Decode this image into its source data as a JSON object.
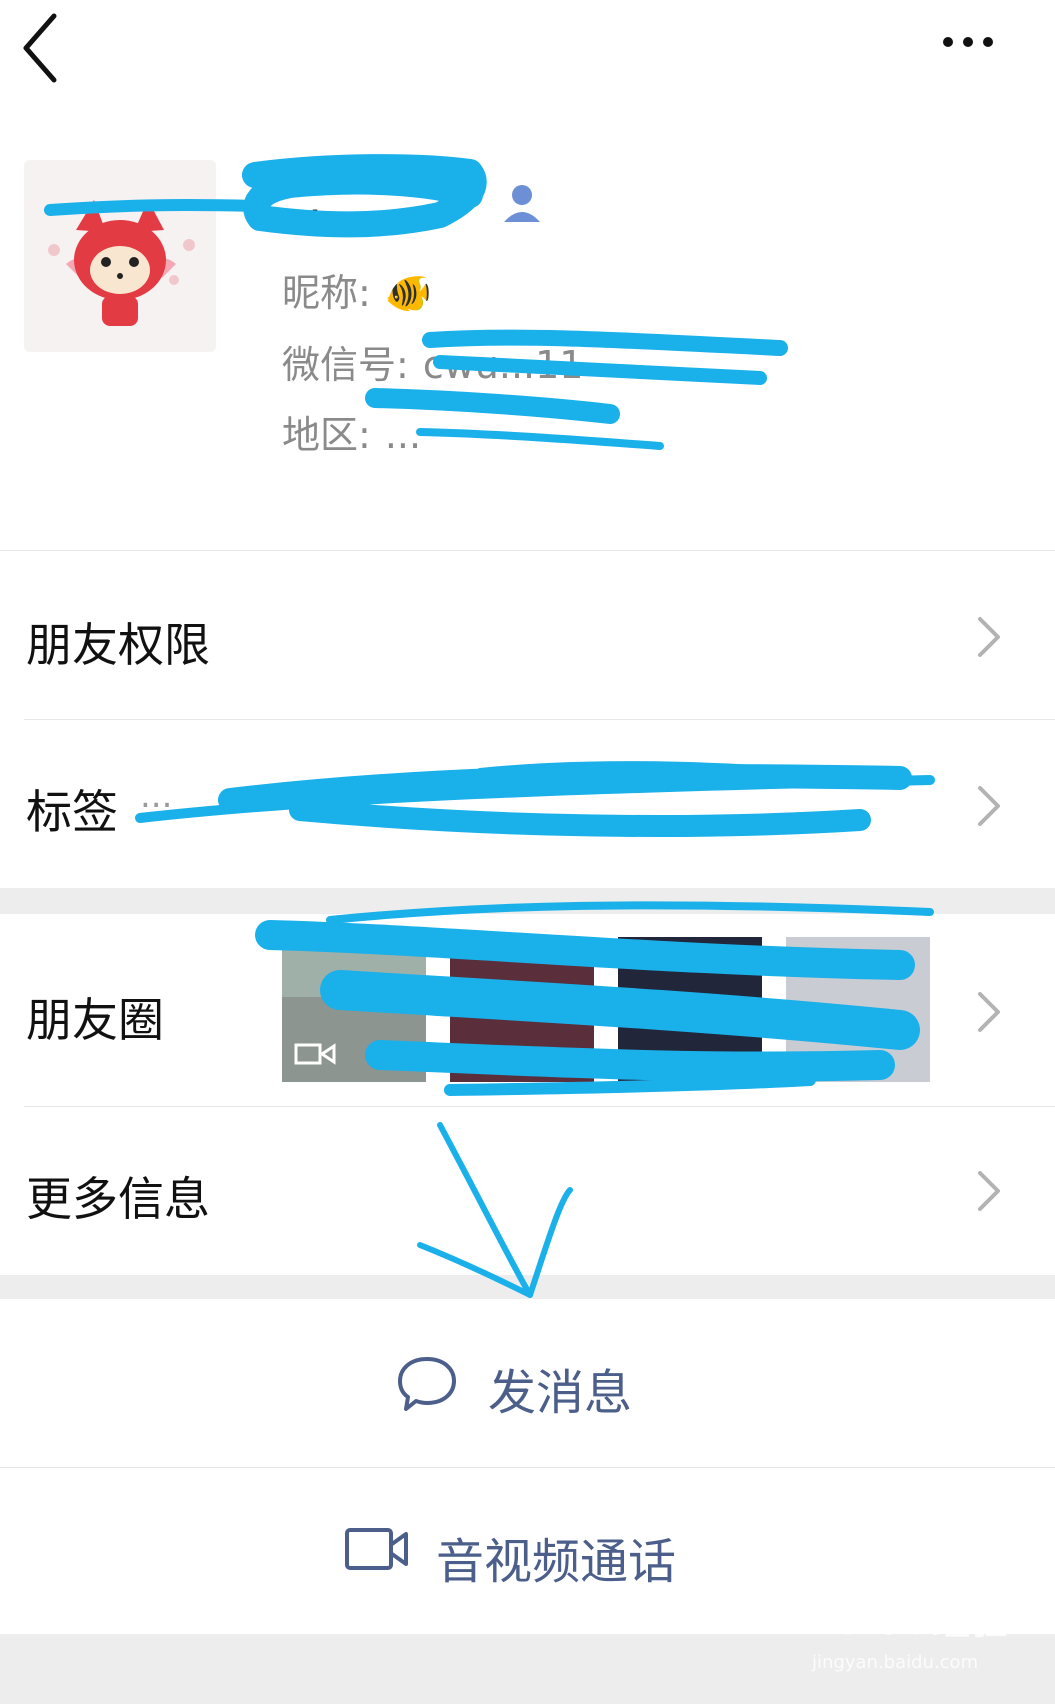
{
  "profile": {
    "nickname_label": "昵称:",
    "nickname_value": "🐠",
    "wechat_id_label": "微信号:",
    "wechat_id_value": "cwu...11",
    "region_label": "地区:",
    "region_value": "...",
    "name_visible": "..."
  },
  "menu": {
    "friend_permissions": "朋友权限",
    "tags": "标签",
    "tags_value": "...",
    "moments": "朋友圈",
    "more_info": "更多信息"
  },
  "actions": {
    "send_message": "发消息",
    "video_call": "音视频通话"
  },
  "watermark": {
    "main": "Baidu经验",
    "sub": "jingyan.baidu.com"
  },
  "colors": {
    "accent_text": "#4b5f8a",
    "scribble": "#1ab0ea",
    "gap": "#ededed"
  }
}
